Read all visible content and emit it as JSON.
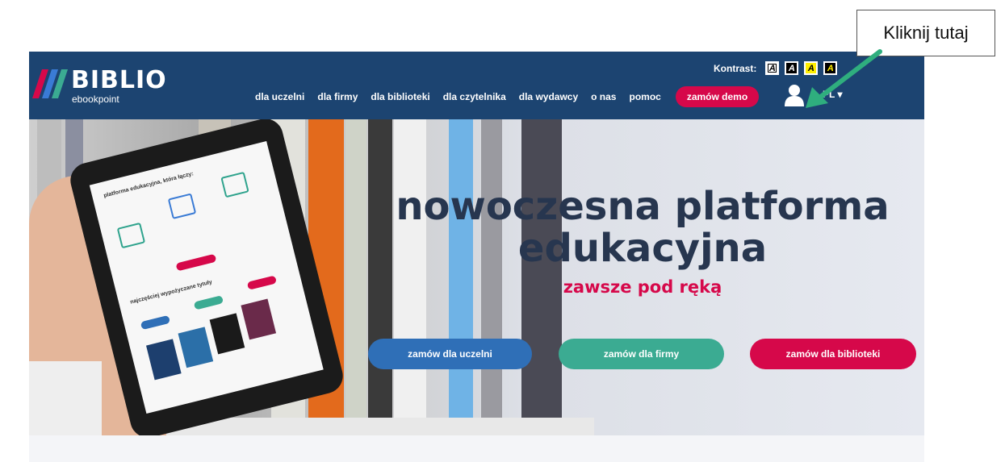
{
  "callout": {
    "text": "Kliknij tutaj"
  },
  "logo": {
    "name": "BIBLIO",
    "sub": "ebookpoint"
  },
  "contrast": {
    "label": "Kontrast:",
    "options": [
      "A",
      "A",
      "A",
      "A"
    ]
  },
  "nav": {
    "items": [
      "dla uczelni",
      "dla firmy",
      "dla biblioteki",
      "dla czytelnika",
      "dla wydawcy",
      "o nas",
      "pomoc"
    ],
    "demo_label": "zamów demo",
    "user_icon": "user-icon",
    "language": "PL ▾"
  },
  "hero": {
    "headline_1": "nowoczesna platforma",
    "headline_2": "edukacyjna",
    "subline": "zawsze pod ręką",
    "buttons": [
      "zamów dla uczelni",
      "zamów dla firmy",
      "zamów dla biblioteki"
    ]
  },
  "tablet": {
    "title": "platforma edukacyjna, która łączy:",
    "title2": "najczęściej wypożyczane tytuły"
  },
  "colors": {
    "header_bg": "#1c4471",
    "accent_red": "#d6084a",
    "accent_blue": "#2f6fb7",
    "accent_green": "#3bab92",
    "headline": "#27364f",
    "arrow": "#2fae7e"
  }
}
